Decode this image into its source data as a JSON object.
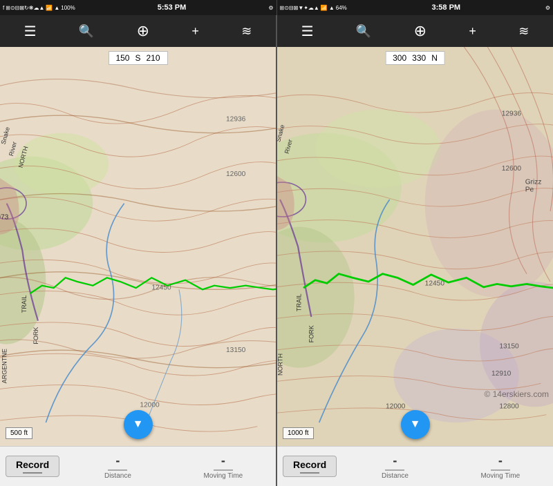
{
  "left_panel": {
    "status": {
      "icons": "≡ ⌂ ⊙ ⊡ ✦ ⊞ ↻ ❋ ☁ ▲ 100%",
      "time": "5:53 PM",
      "battery": "100%"
    },
    "toolbar": {
      "menu_icon": "☰",
      "search_icon": "🔍",
      "crosshair_icon": "⊕",
      "plus_icon": "+",
      "layers_icon": "⊞"
    },
    "compass": {
      "left_val": "150",
      "direction": "S",
      "right_val": "210"
    },
    "scale": "500 ft",
    "bottom": {
      "record_label": "Record",
      "distance_label": "Distance",
      "distance_val": "-",
      "moving_time_label": "Moving Time",
      "moving_time_val": "-"
    }
  },
  "right_panel": {
    "status": {
      "time": "3:58 PM",
      "battery": "64%"
    },
    "toolbar": {
      "menu_icon": "☰",
      "search_icon": "🔍",
      "crosshair_icon": "⊕",
      "plus_icon": "+",
      "layers_icon": "⊞"
    },
    "compass": {
      "left_val": "300",
      "mid_val": "330",
      "direction": "N"
    },
    "scale": "1000 ft",
    "bottom": {
      "record_label": "Record",
      "distance_label": "Distance",
      "distance_val": "-",
      "moving_time_label": "Moving Time",
      "moving_time_val": "-"
    }
  },
  "watermark": "© 14erskiers.com"
}
